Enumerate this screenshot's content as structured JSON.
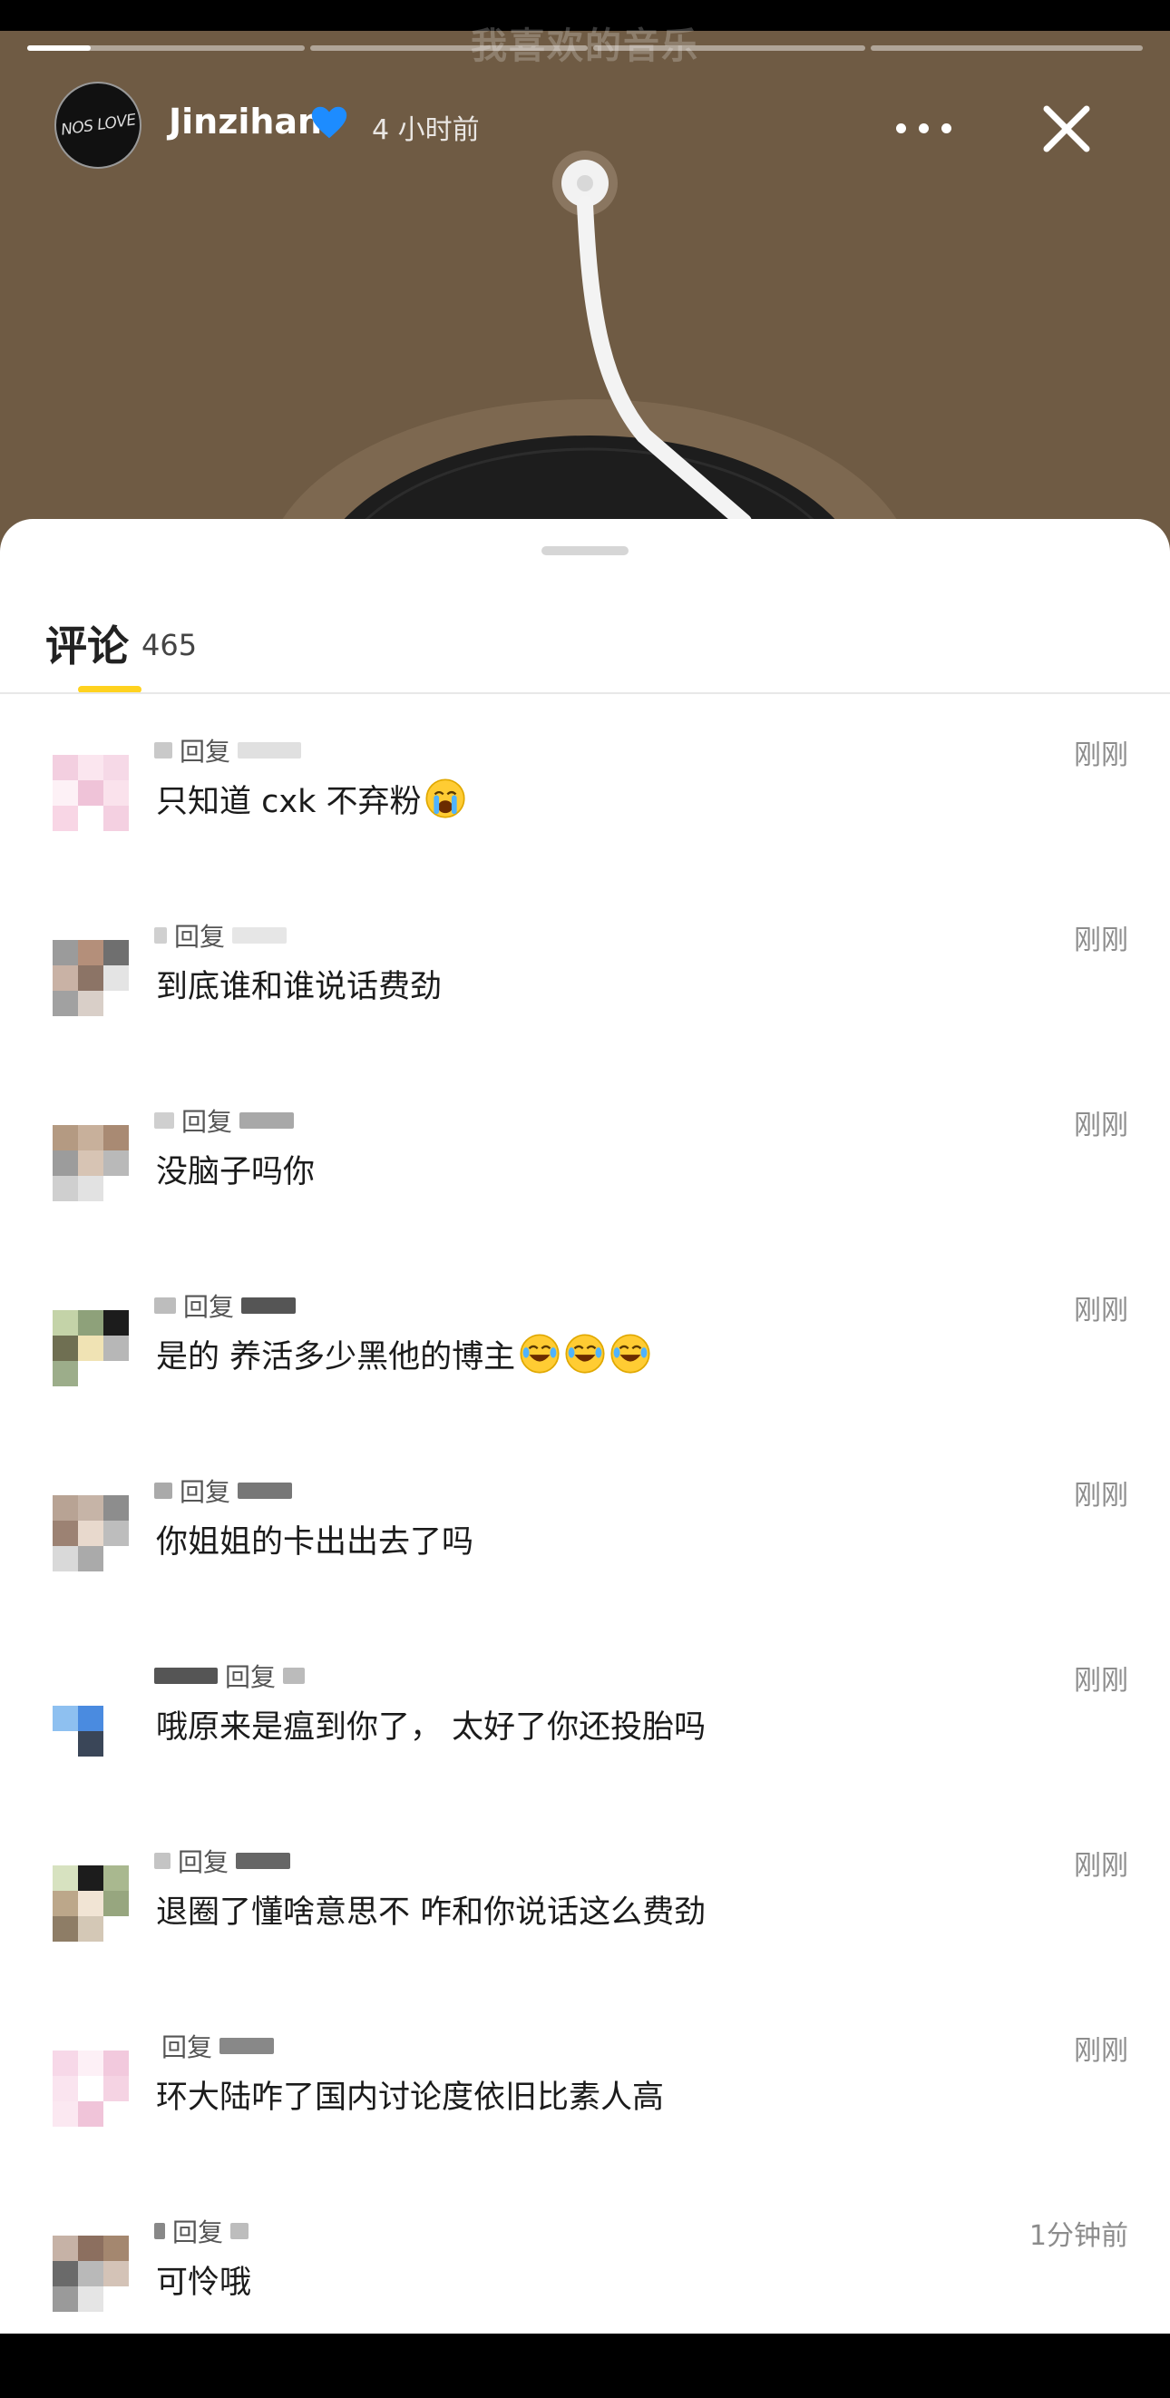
{
  "story": {
    "username": "Jinzihan",
    "verified_icon": "blue-heart-emoji",
    "time_ago": "4 小时前",
    "avatar_text": "NOS LOVE",
    "faded_title": "我喜欢的音乐",
    "background_color": "#6f5b44",
    "progress_segments": 4,
    "progress_current_fill": 0.23
  },
  "comments_header": {
    "title": "评论",
    "count": "465",
    "accent_color": "#ffd21f"
  },
  "comments": [
    {
      "reply_word": "回复",
      "text": "只知道 cxk 不弃粉",
      "emoji": [
        "loudly-crying-face"
      ],
      "time": "刚刚"
    },
    {
      "reply_word": "回复",
      "text": "到底谁和谁说话费劲",
      "emoji": [],
      "time": "刚刚"
    },
    {
      "reply_word": "回复",
      "text": "没脑子吗你",
      "emoji": [],
      "time": "刚刚"
    },
    {
      "reply_word": "回复",
      "text": "是的 养活多少黑他的博主",
      "emoji": [
        "tears-of-joy",
        "tears-of-joy",
        "tears-of-joy"
      ],
      "time": "刚刚"
    },
    {
      "reply_word": "回复",
      "text": "你姐姐的卡出出去了吗",
      "emoji": [],
      "time": "刚刚"
    },
    {
      "reply_word": "回复",
      "text": "哦原来是瘟到你了， 太好了你还投胎吗",
      "emoji": [],
      "time": "刚刚"
    },
    {
      "reply_word": "回复",
      "text": "退圈了懂啥意思不 咋和你说话这么费劲",
      "emoji": [],
      "time": "刚刚"
    },
    {
      "reply_word": "回复",
      "text": "环大陆咋了国内讨论度依旧比素人高",
      "emoji": [],
      "time": "刚刚"
    },
    {
      "reply_word": "回复",
      "text": "可怜哦",
      "emoji": [],
      "time": "1分钟前"
    }
  ]
}
